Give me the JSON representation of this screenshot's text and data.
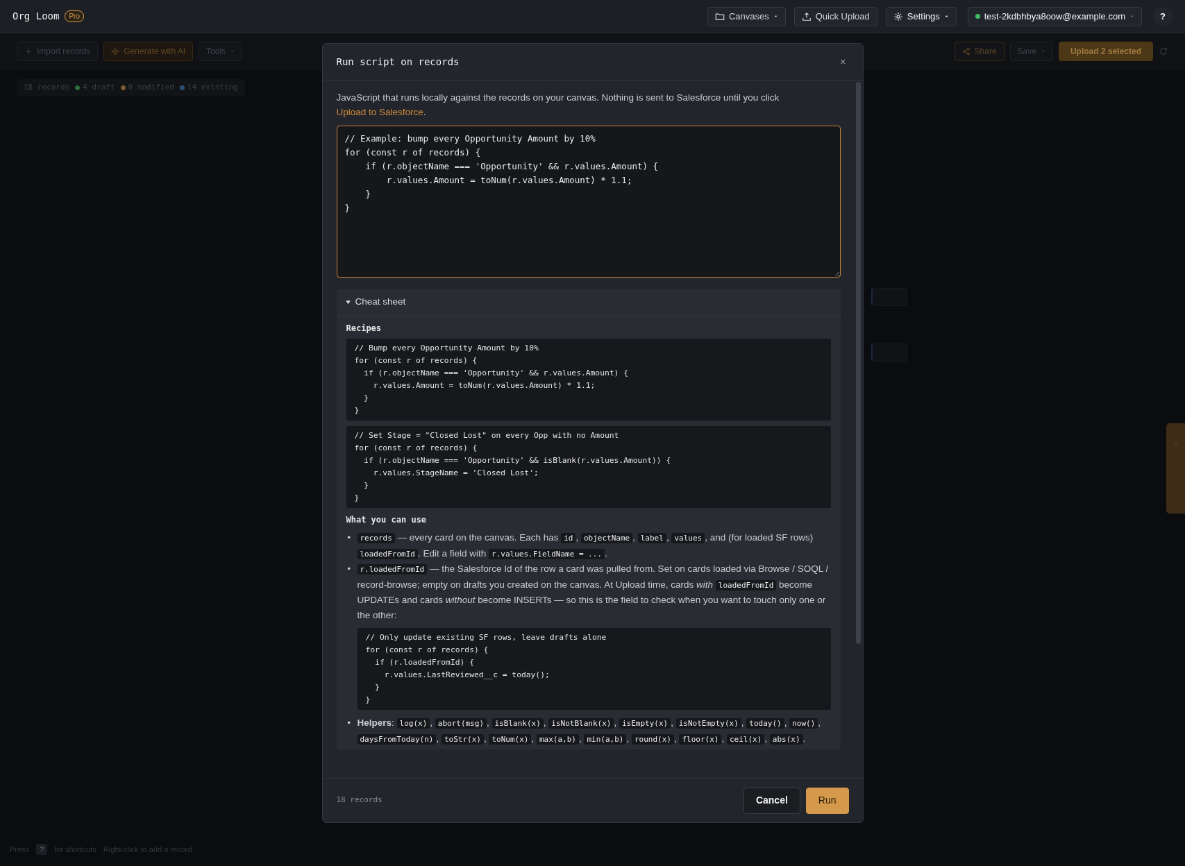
{
  "app": {
    "name": "Org Loom",
    "plan": "Pro"
  },
  "header_actions": [
    {
      "label": "Canvases",
      "kind": "folder",
      "dropdown": true
    },
    {
      "label": "Quick Upload",
      "kind": "upload",
      "dropdown": false
    },
    {
      "label": "Settings",
      "kind": "gear",
      "dropdown": true
    }
  ],
  "account": {
    "email": "test-2kdbhbya8oow@example.com",
    "online": true
  },
  "help": "?",
  "toolbar_left": [
    {
      "label": "Import records",
      "kind": "plus"
    },
    {
      "label": "Generate with AI",
      "kind": "ai"
    },
    {
      "label": "Tools",
      "kind": "menu"
    }
  ],
  "toolbar_right": [
    {
      "label": "Share",
      "kind": "share"
    },
    {
      "label": "Save",
      "kind": "menu"
    },
    {
      "label": "Upload 2 selected",
      "kind": "primary"
    }
  ],
  "stats": {
    "total": "18 records",
    "parts": [
      {
        "label": "4 draft",
        "color": "#2c6a3a"
      },
      {
        "label": "0 modified",
        "color": "#7a5a2c"
      },
      {
        "label": "14 existing",
        "color": "#2a4f72"
      }
    ]
  },
  "hint": {
    "press": "Press",
    "key": "?",
    "shortcuts": "for shortcuts",
    "right_click": "Right-click to add a record"
  },
  "modal": {
    "title": "Run script on records",
    "close": "×",
    "description": {
      "before": "JavaScript that runs locally against the records on your canvas. Nothing is sent to Salesforce until you click ",
      "link": "Upload to Salesforce",
      "after": "."
    },
    "script": "// Example: bump every Opportunity Amount by 10%\nfor (const r of records) {\n    if (r.objectName === 'Opportunity' && r.values.Amount) {\n        r.values.Amount = toNum(r.values.Amount) * 1.1;\n    }\n}",
    "cheat_sheet": {
      "title": "Cheat sheet",
      "expanded": true,
      "recipes_heading": "Recipes",
      "recipes": [
        "// Bump every Opportunity Amount by 10%\nfor (const r of records) {\n  if (r.objectName === 'Opportunity' && r.values.Amount) {\n    r.values.Amount = toNum(r.values.Amount) * 1.1;\n  }\n}",
        "// Set Stage = \"Closed Lost\" on every Opp with no Amount\nfor (const r of records) {\n  if (r.objectName === 'Opportunity' && isBlank(r.values.Amount)) {\n    r.values.StageName = 'Closed Lost';\n  }\n}"
      ],
      "use_heading": "What you can use",
      "items": [
        {
          "marker": "•",
          "parts": [
            {
              "kind": "code",
              "text": "records"
            },
            {
              "kind": "text",
              "text": " — every card on the canvas. Each has "
            },
            {
              "kind": "code",
              "text": "id"
            },
            {
              "kind": "text",
              "text": ", "
            },
            {
              "kind": "code",
              "text": "objectName"
            },
            {
              "kind": "text",
              "text": ", "
            },
            {
              "kind": "code",
              "text": "label"
            },
            {
              "kind": "text",
              "text": ", "
            },
            {
              "kind": "code",
              "text": "values"
            },
            {
              "kind": "text",
              "text": ", and (for loaded SF rows) "
            },
            {
              "kind": "code",
              "text": "loadedFromId"
            },
            {
              "kind": "text",
              "text": ". Edit a field with "
            },
            {
              "kind": "code",
              "text": "r.values.FieldName = ..."
            },
            {
              "kind": "text",
              "text": "."
            }
          ]
        },
        {
          "marker": "•",
          "parts": [
            {
              "kind": "code",
              "text": "r.loadedFromId"
            },
            {
              "kind": "text",
              "text": " — the Salesforce Id of the row a card was pulled from. Set on cards loaded via Browse / SOQL / record-browse; empty on drafts you created on the canvas. At Upload time, cards *with* "
            },
            {
              "kind": "code",
              "text": "loadedFromId"
            },
            {
              "kind": "text",
              "text": " become UPDATEs and cards *without* become INSERTs — so this is the field to check when you want to touch only one or the other:"
            }
          ],
          "code_block": "// Only update existing SF rows, leave drafts alone\nfor (const r of records) {\n  if (r.loadedFromId) {\n    r.values.LastReviewed__c = today();\n  }\n}"
        },
        {
          "marker": "•",
          "parts": [
            {
              "kind": "text",
              "text": "**Helpers**: "
            },
            {
              "kind": "code",
              "text": "log(x)"
            },
            {
              "kind": "text",
              "text": ", "
            },
            {
              "kind": "code",
              "text": "abort(msg)"
            },
            {
              "kind": "text",
              "text": ", "
            },
            {
              "kind": "code",
              "text": "isBlank(x)"
            },
            {
              "kind": "text",
              "text": ", "
            },
            {
              "kind": "code",
              "text": "isNotBlank(x)"
            },
            {
              "kind": "text",
              "text": ", "
            },
            {
              "kind": "code",
              "text": "isEmpty(x)"
            },
            {
              "kind": "text",
              "text": ", "
            },
            {
              "kind": "code",
              "text": "isNotEmpty(x)"
            },
            {
              "kind": "text",
              "text": ", "
            },
            {
              "kind": "code",
              "text": "today()"
            },
            {
              "kind": "text",
              "text": ", "
            },
            {
              "kind": "code",
              "text": "now()"
            },
            {
              "kind": "text",
              "text": ", "
            },
            {
              "kind": "code",
              "text": "daysFromToday(n)"
            },
            {
              "kind": "text",
              "text": ", "
            },
            {
              "kind": "code",
              "text": "toStr(x)"
            },
            {
              "kind": "text",
              "text": ", "
            },
            {
              "kind": "code",
              "text": "toNum(x)"
            },
            {
              "kind": "text",
              "text": ", "
            },
            {
              "kind": "code",
              "text": "max(a,b)"
            },
            {
              "kind": "text",
              "text": ", "
            },
            {
              "kind": "code",
              "text": "min(a,b)"
            },
            {
              "kind": "text",
              "text": ", "
            },
            {
              "kind": "code",
              "text": "round(x)"
            },
            {
              "kind": "text",
              "text": ", "
            },
            {
              "kind": "code",
              "text": "floor(x)"
            },
            {
              "kind": "text",
              "text": ", "
            },
            {
              "kind": "code",
              "text": "ceil(x)"
            },
            {
              "kind": "text",
              "text": ", "
            },
            {
              "kind": "code",
              "text": "abs(x)"
            },
            {
              "kind": "text",
              "text": "."
            }
          ]
        }
      ]
    },
    "footer": {
      "count": "18 records",
      "buttons": [
        {
          "label": "Cancel",
          "kind": "secondary"
        },
        {
          "label": "Run",
          "kind": "primary"
        }
      ]
    }
  }
}
